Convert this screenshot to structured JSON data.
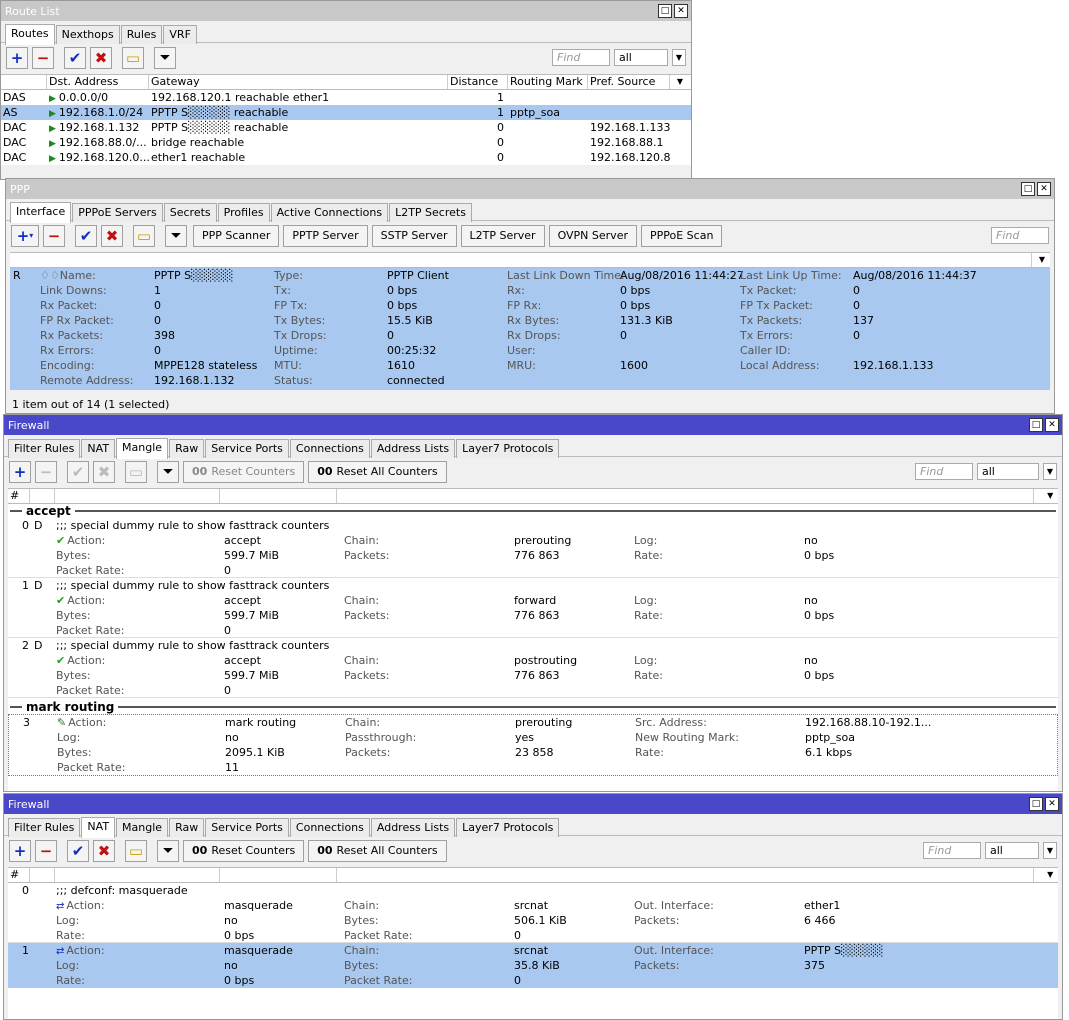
{
  "route": {
    "title": "Route List",
    "tabs": [
      "Routes",
      "Nexthops",
      "Rules",
      "VRF"
    ],
    "find_placeholder": "Find",
    "filter_value": "all",
    "columns": [
      "Dst. Address",
      "Gateway",
      "Distance",
      "Routing Mark",
      "Pref. Source"
    ],
    "rows": [
      {
        "flags": "DAS",
        "dst": "0.0.0.0/0",
        "gateway": "192.168.120.1 reachable ether1",
        "distance": "1",
        "mark": "",
        "pref": ""
      },
      {
        "flags": "AS",
        "dst": "192.168.1.0/24",
        "gateway": "PPTP S░░░░░ reachable",
        "distance": "1",
        "mark": "pptp_soa",
        "pref": ""
      },
      {
        "flags": "DAC",
        "dst": "192.168.1.132",
        "gateway": "PPTP S░░░░░ reachable",
        "distance": "0",
        "mark": "",
        "pref": "192.168.1.133"
      },
      {
        "flags": "DAC",
        "dst": "192.168.88.0/...",
        "gateway": "bridge reachable",
        "distance": "0",
        "mark": "",
        "pref": "192.168.88.1"
      },
      {
        "flags": "DAC",
        "dst": "192.168.120.0...",
        "gateway": "ether1 reachable",
        "distance": "0",
        "mark": "",
        "pref": "192.168.120.88"
      }
    ]
  },
  "ppp": {
    "title": "PPP",
    "tabs": [
      "Interface",
      "PPPoE Servers",
      "Secrets",
      "Profiles",
      "Active Connections",
      "L2TP Secrets"
    ],
    "buttons": [
      "PPP Scanner",
      "PPTP Server",
      "SSTP Server",
      "L2TP Server",
      "OVPN Server",
      "PPPoE Scan"
    ],
    "find_placeholder": "Find",
    "row_flag": "R",
    "fields": [
      [
        "♢♢Name:",
        "PPTP S░░░░░",
        "Type:",
        "PPTP Client",
        "Last Link Down Time:",
        "Aug/08/2016 11:44:27",
        "Last Link Up Time:",
        "Aug/08/2016 11:44:37"
      ],
      [
        "Link Downs:",
        "1",
        "Tx:",
        "0 bps",
        "Rx:",
        "0 bps",
        "Tx Packet:",
        "0"
      ],
      [
        "Rx Packet:",
        "0",
        "FP Tx:",
        "0 bps",
        "FP Rx:",
        "0 bps",
        "FP Tx Packet:",
        "0"
      ],
      [
        "FP Rx Packet:",
        "0",
        "Tx Bytes:",
        "15.5 KiB",
        "Rx Bytes:",
        "131.3 KiB",
        "Tx Packets:",
        "137"
      ],
      [
        "Rx Packets:",
        "398",
        "Tx Drops:",
        "0",
        "Rx Drops:",
        "0",
        "Tx Errors:",
        "0"
      ],
      [
        "Rx Errors:",
        "0",
        "Uptime:",
        "00:25:32",
        "User:",
        "",
        "Caller ID:",
        ""
      ],
      [
        "Encoding:",
        "MPPE128 stateless",
        "MTU:",
        "1610",
        "MRU:",
        "1600",
        "Local Address:",
        "192.168.1.133"
      ],
      [
        "Remote Address:",
        "192.168.1.132",
        "Status:",
        "connected",
        "",
        "",
        "",
        ""
      ]
    ],
    "status": "1 item out of 14 (1 selected)"
  },
  "mangle": {
    "title": "Firewall",
    "tabs": [
      "Filter Rules",
      "NAT",
      "Mangle",
      "Raw",
      "Service Ports",
      "Connections",
      "Address Lists",
      "Layer7 Protocols"
    ],
    "reset_counters": "Reset Counters",
    "reset_all": "Reset All Counters",
    "find_placeholder": "Find",
    "filter_value": "all",
    "hash": "#",
    "section_accept": "accept",
    "section_mark": "mark routing",
    "rules": [
      {
        "num": "0",
        "flag": "D",
        "comment": ";;; special dummy rule to show fasttrack counters",
        "action": "accept",
        "chain": "prerouting",
        "log": "no",
        "bytes": "599.7 MiB",
        "packets": "776 863",
        "rate": "0 bps",
        "packet_rate": "0"
      },
      {
        "num": "1",
        "flag": "D",
        "comment": ";;; special dummy rule to show fasttrack counters",
        "action": "accept",
        "chain": "forward",
        "log": "no",
        "bytes": "599.7 MiB",
        "packets": "776 863",
        "rate": "0 bps",
        "packet_rate": "0"
      },
      {
        "num": "2",
        "flag": "D",
        "comment": ";;; special dummy rule to show fasttrack counters",
        "action": "accept",
        "chain": "postrouting",
        "log": "no",
        "bytes": "599.7 MiB",
        "packets": "776 863",
        "rate": "0 bps",
        "packet_rate": "0"
      }
    ],
    "mark_rule": {
      "num": "3",
      "action": "mark routing",
      "chain": "prerouting",
      "src": "192.168.88.10-192.1...",
      "log": "no",
      "passthrough": "yes",
      "new_mark": "pptp_soa",
      "bytes": "2095.1 KiB",
      "packets": "23 858",
      "rate": "6.1 kbps",
      "packet_rate": "11"
    },
    "labels": {
      "action": "Action:",
      "chain": "Chain:",
      "log": "Log:",
      "bytes": "Bytes:",
      "packets": "Packets:",
      "rate": "Rate:",
      "packet_rate": "Packet Rate:",
      "src": "Src. Address:",
      "passthrough": "Passthrough:",
      "new_mark": "New Routing Mark:"
    }
  },
  "nat": {
    "title": "Firewall",
    "tabs": [
      "Filter Rules",
      "NAT",
      "Mangle",
      "Raw",
      "Service Ports",
      "Connections",
      "Address Lists",
      "Layer7 Protocols"
    ],
    "reset_counters": "Reset Counters",
    "reset_all": "Reset All Counters",
    "find_placeholder": "Find",
    "filter_value": "all",
    "hash": "#",
    "r0": {
      "num": "0",
      "comment": ";;; defconf: masquerade",
      "action": "masquerade",
      "chain": "srcnat",
      "out": "ether1",
      "log": "no",
      "bytes": "506.1 KiB",
      "packets": "6 466",
      "rate": "0 bps",
      "packet_rate": "0"
    },
    "r1": {
      "num": "1",
      "action": "masquerade",
      "chain": "srcnat",
      "out": "PPTP S░░░░░",
      "log": "no",
      "bytes": "35.8 KiB",
      "packets": "375",
      "rate": "0 bps",
      "packet_rate": "0"
    },
    "labels": {
      "action": "Action:",
      "chain": "Chain:",
      "out": "Out. Interface:",
      "log": "Log:",
      "bytes": "Bytes:",
      "packets": "Packets:",
      "rate": "Rate:",
      "packet_rate": "Packet Rate:"
    }
  }
}
